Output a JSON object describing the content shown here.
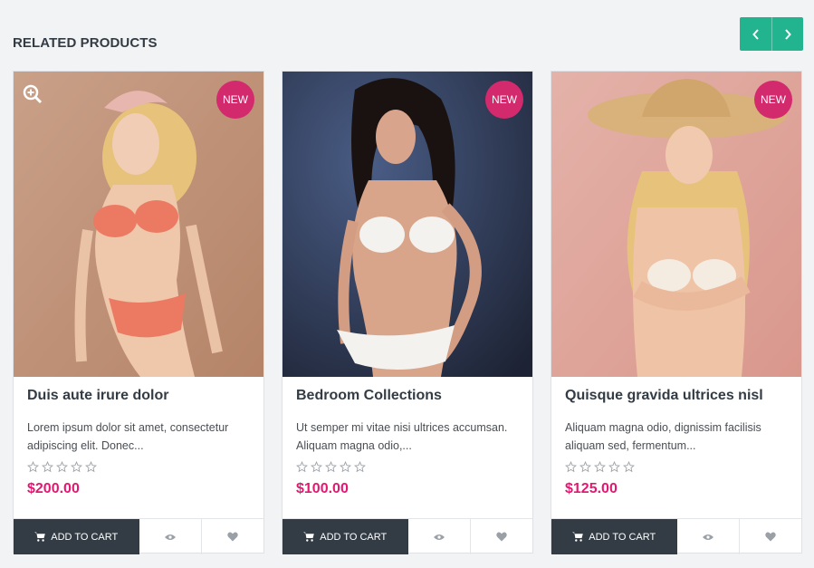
{
  "section": {
    "title": "RELATED PRODUCTS"
  },
  "navigation": {
    "prev_icon": "chevron-left-icon",
    "next_icon": "chevron-right-icon",
    "accent_color": "#22b48f"
  },
  "colors": {
    "badge": "#d32a6d",
    "price": "#e01a71",
    "cart_button": "#333c44"
  },
  "products": [
    {
      "badge": "NEW",
      "title": "Duis aute irure dolor",
      "description": "Lorem ipsum dolor sit amet, consectetur adipiscing elit. Donec...",
      "rating": 0,
      "price": "$200.00",
      "cart_label": "ADD TO CART",
      "image_icon": "photo-model-coral-lingerie"
    },
    {
      "badge": "NEW",
      "title": "Bedroom Collections",
      "description": "Ut semper mi vitae nisi ultrices accumsan. Aliquam magna odio,...",
      "rating": 0,
      "price": "$100.00",
      "cart_label": "ADD TO CART",
      "image_icon": "photo-model-white-lingerie"
    },
    {
      "badge": "NEW",
      "title": "Quisque gravida ultrices nisl",
      "description": "Aliquam magna odio, dignissim facilisis aliquam sed, fermentum...",
      "rating": 0,
      "price": "$125.00",
      "cart_label": "ADD TO CART",
      "image_icon": "photo-model-sun-hat"
    }
  ]
}
